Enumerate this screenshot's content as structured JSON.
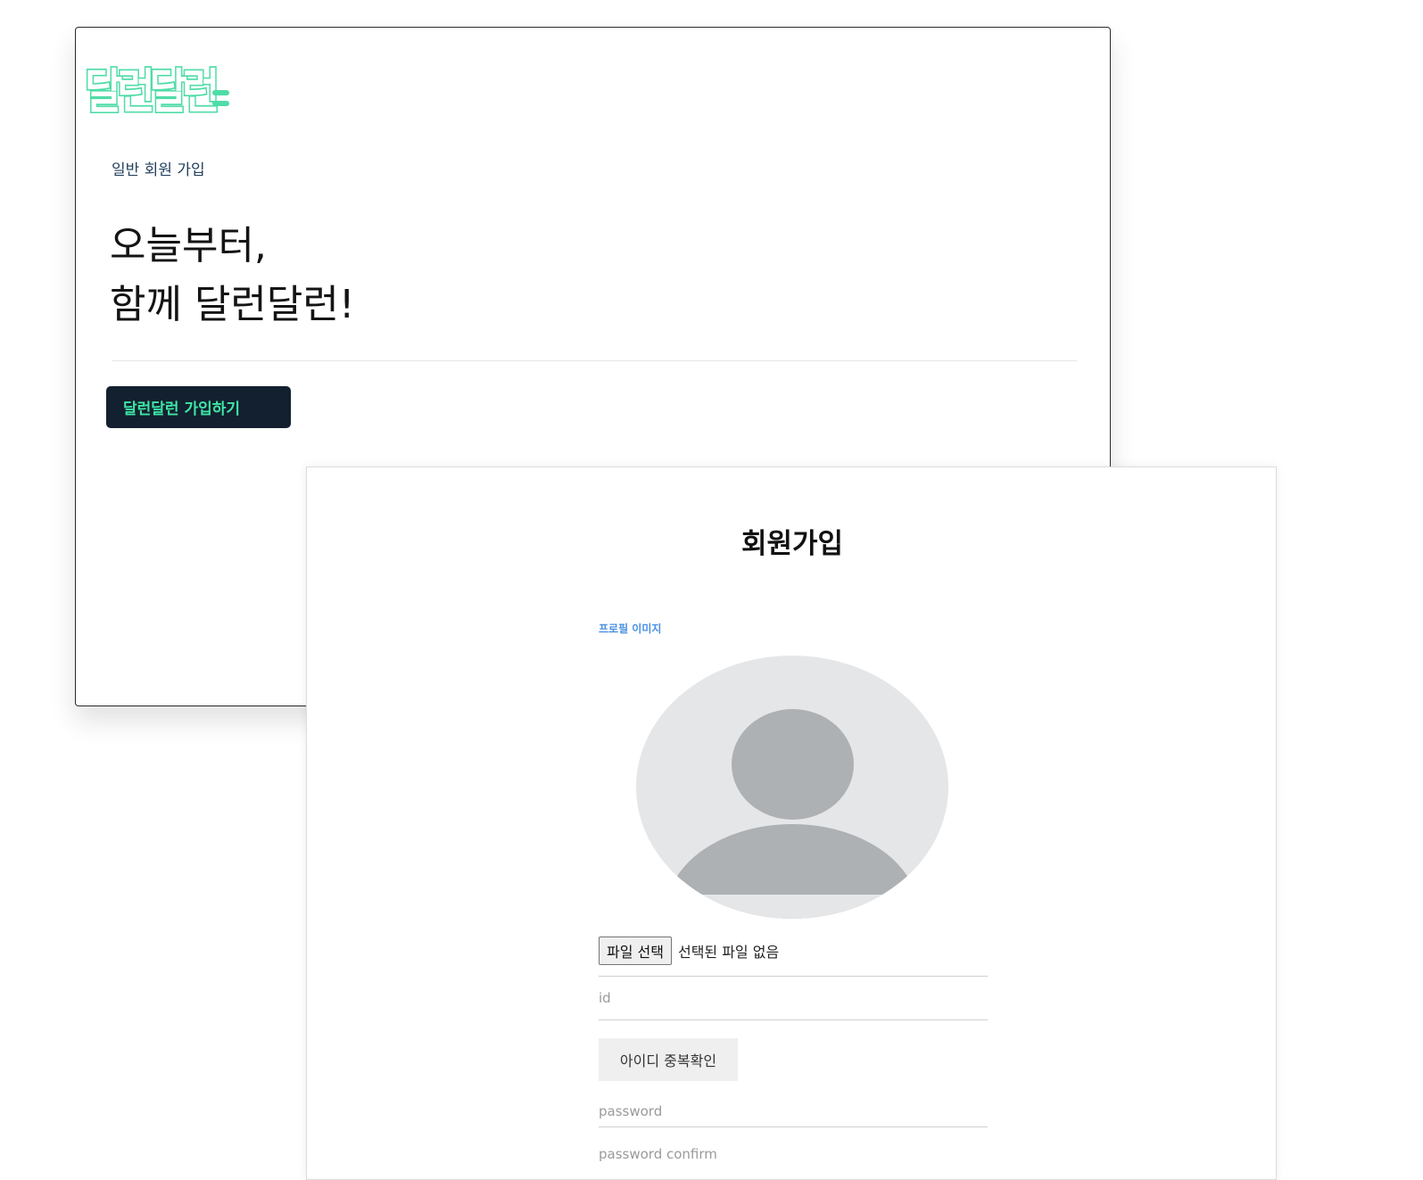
{
  "landing": {
    "logo_text": "달런달런",
    "subtitle": "일반 회원 가입",
    "headline_line1": "오늘부터,",
    "headline_line2": "함께 달런달런!",
    "join_button": "달런달런 가입하기",
    "brand_color": "#4fdca6",
    "button_bg": "#13202f",
    "button_text_color": "#3ee6a5"
  },
  "signup": {
    "title": "회원가입",
    "profile_label": "프로필 이미지",
    "avatar_icon": "default-user-icon",
    "file_button": "파일 선택",
    "file_status": "선택된 파일 없음",
    "id_placeholder": "id",
    "id_check_button": "아이디 중복확인",
    "password_placeholder": "password",
    "password_confirm_placeholder": "password confirm",
    "label_color": "#4a90e2"
  }
}
